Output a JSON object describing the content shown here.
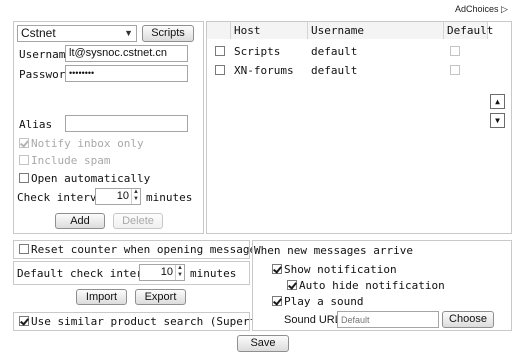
{
  "adchoices": {
    "label": "AdChoices"
  },
  "account": {
    "selected_account": "Cstnet",
    "scripts_button": "Scripts",
    "username_label": "Username",
    "username_value": "lt@sysnoc.cstnet.cn",
    "password_label": "Password",
    "password_value": "••••••••",
    "alias_label": "Alias",
    "alias_value": "",
    "notify_inbox_only": "Notify inbox only",
    "include_spam": "Include spam",
    "open_automatically": "Open automatically",
    "check_interval_label": "Check interval",
    "check_interval_value": "10",
    "minutes_label": "minutes",
    "add_button": "Add",
    "delete_button": "Delete"
  },
  "accounts_table": {
    "headers": [
      "Host",
      "Username",
      "Default"
    ],
    "rows": [
      {
        "host": "Scripts",
        "username": "default"
      },
      {
        "host": "XN-forums",
        "username": "default"
      }
    ]
  },
  "general": {
    "reset_counter": "Reset counter when opening messages",
    "default_check_interval_label": "Default check interval",
    "default_check_interval_value": "10",
    "minutes_label": "minutes",
    "import_button": "Import",
    "export_button": "Export",
    "similar_product_search": "Use similar product search (Superfish)"
  },
  "new_messages": {
    "heading": "When new messages arrive",
    "show_notification": "Show notification",
    "auto_hide_notification": "Auto hide notification",
    "play_sound": "Play a sound",
    "sound_url_label": "Sound URL",
    "sound_url_placeholder": "Default",
    "choose_button": "Choose"
  },
  "save_button": "Save"
}
